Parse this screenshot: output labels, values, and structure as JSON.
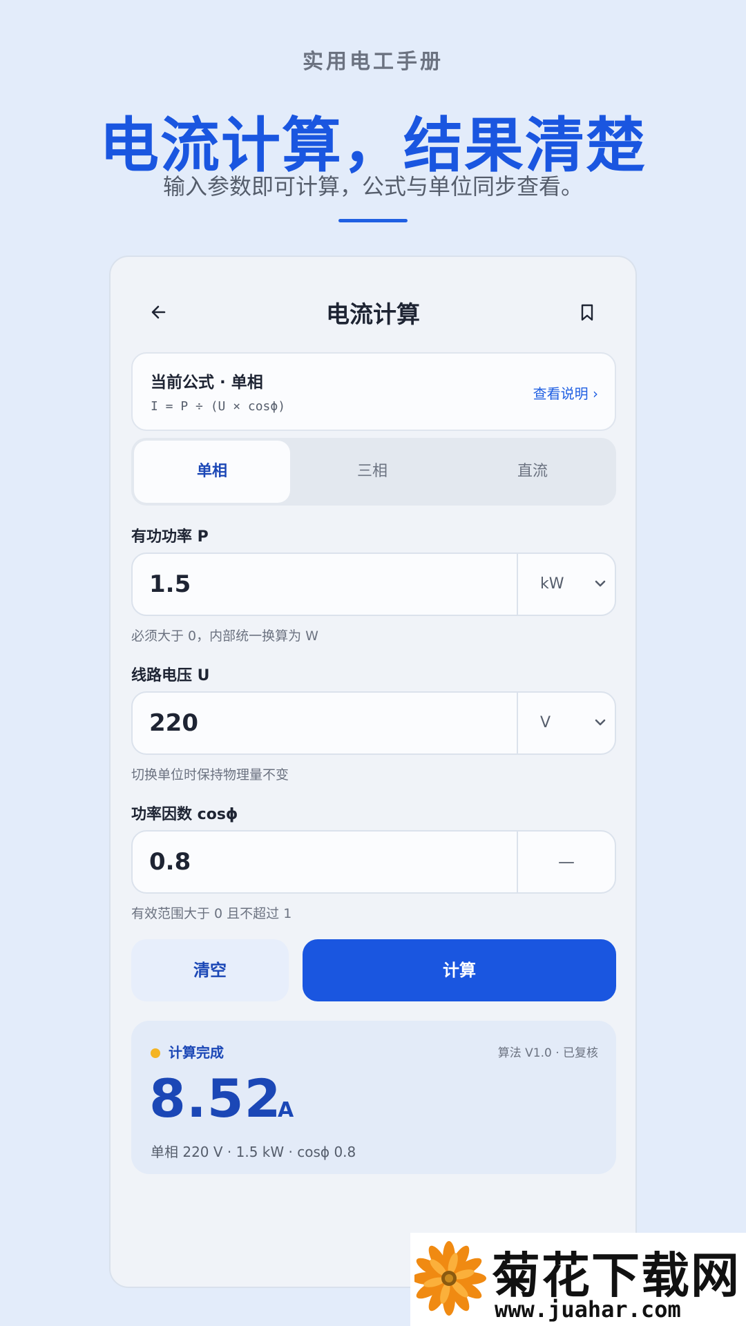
{
  "hero": {
    "kicker": "实用电工手册",
    "title": "电流计算，结果清楚",
    "subtitle": "输入参数即可计算，公式与单位同步查看。"
  },
  "screen": {
    "title": "电流计算",
    "back_icon": "arrow-left-icon",
    "bookmark_icon": "bookmark-icon"
  },
  "formula": {
    "label": "当前公式 · 单相",
    "expression": "I = P ÷ (U × cosϕ)",
    "link": "查看说明 ›"
  },
  "tabs": [
    {
      "label": "单相",
      "active": true
    },
    {
      "label": "三相",
      "active": false
    },
    {
      "label": "直流",
      "active": false
    }
  ],
  "fields": {
    "power": {
      "label": "有功功率 P",
      "value": "1.5",
      "unit": "kW",
      "hint": "必须大于 0，内部统一换算为 W"
    },
    "voltage": {
      "label": "线路电压 U",
      "value": "220",
      "unit": "V",
      "hint": "切换单位时保持物理量不变"
    },
    "pf": {
      "label": "功率因数 cosϕ",
      "value": "0.8",
      "unit": "—",
      "hint": "有效范围大于 0 且不超过 1"
    }
  },
  "buttons": {
    "clear": "清空",
    "calculate": "计算"
  },
  "result": {
    "status": "计算完成",
    "meta": "算法 V1.0 · 已复核",
    "value": "8.52",
    "unit": "A",
    "detail": "单相 220 V · 1.5 kW · cosϕ 0.8",
    "status_color": "#f4b424"
  },
  "watermark": {
    "text": "菊花下载网",
    "url": "www.juahar.com"
  },
  "colors": {
    "accent": "#1a56e0",
    "background": "#e3ecfa"
  }
}
